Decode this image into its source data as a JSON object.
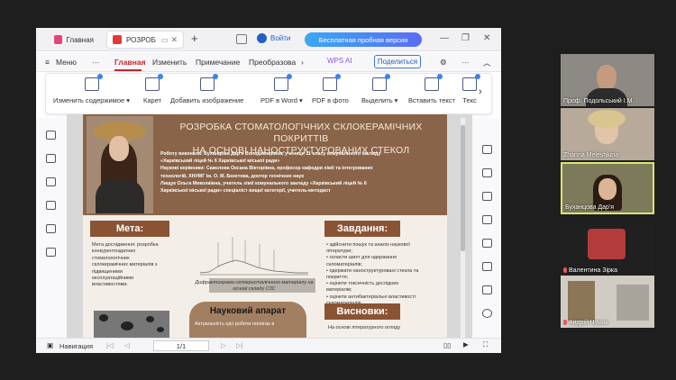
{
  "window": {
    "tabs": [
      {
        "label": "Главная"
      },
      {
        "label": "РОЗРОБ"
      }
    ],
    "login_label": "Войти",
    "trial_label": "Бесплатная пробная версия"
  },
  "menu": {
    "items": [
      "Меню",
      "Главная",
      "Изменить",
      "Примечание",
      "Преобразова"
    ],
    "wps_ai": "WPS AI",
    "share": "Поделиться"
  },
  "ribbon": {
    "buttons": [
      "Изменить содержимое ▾",
      "Карет",
      "Добавить изображение",
      "PDF в Word ▾",
      "PDF в фото",
      "Выделить ▾",
      "Вставить текст",
      "Текс"
    ]
  },
  "poster": {
    "title_line1": "РОЗРОБКА СТОМАТОЛОГІЧНИХ СКЛОКЕРАМІЧНИХ ПОКРИТТІВ",
    "title_line2": "НА ОСНОВІ НАНОСТРУКТУРОВАНИХ СТЕКОЛ",
    "info": [
      "Роботу виконала: Буханцова Дар'я Володимирівна, учениця 11 класу комунального закладу",
      "«Харківський ліцей № 6 Харківської міської ради»",
      "Наукові керівники: Савєлова Оксана Вікторівна, професор кафедри хімії та інтегрованих",
      "технологій, ХНУМГ ім. О. М. Бекетова, доктор технічних наук",
      "Лищук Ольга Миколаївна, учитель хімії комунального закладу «Харківський ліцей № 6",
      "Харківської міської ради» спеціаліст вищої категорії, учитель-методист"
    ],
    "meta_title": "Мета:",
    "meta_text": "Мета дослідження: розробка конкурентоздатних стоматологічних склокерамічних матеріалів з підвищеними експлуатаційними властивостями.",
    "chart_caption": "Дифрактограма склокристалічного матеріалу на основі складу С3С",
    "tasks_title": "Завдання:",
    "tasks": [
      "здійснити пошук та аналіз наукової літератури;",
      "скласти шихт для одержання скломатеріалів;",
      "одержати наноструктуровані стекла та покриття;",
      "оцінити токсичність дослідних матеріалів;",
      "оцінити антибактеріальні властивості скломатеріалів"
    ],
    "science_title": "Науковий апарат",
    "science_text": "Актуальність цієї роботи полягає в",
    "conclusions_title": "Висновки:",
    "conclusions_text": "На основі літературного огляду"
  },
  "status": {
    "navigation": "Навигация",
    "page": "1/1"
  },
  "participants": [
    {
      "name": "Проф. Подольський І.М."
    },
    {
      "name": "Zhanna Meleshkina"
    },
    {
      "name": "Буханцова Дар'я"
    },
    {
      "name": "Валентина Зірка"
    },
    {
      "name": "Андрій Чумак"
    }
  ]
}
